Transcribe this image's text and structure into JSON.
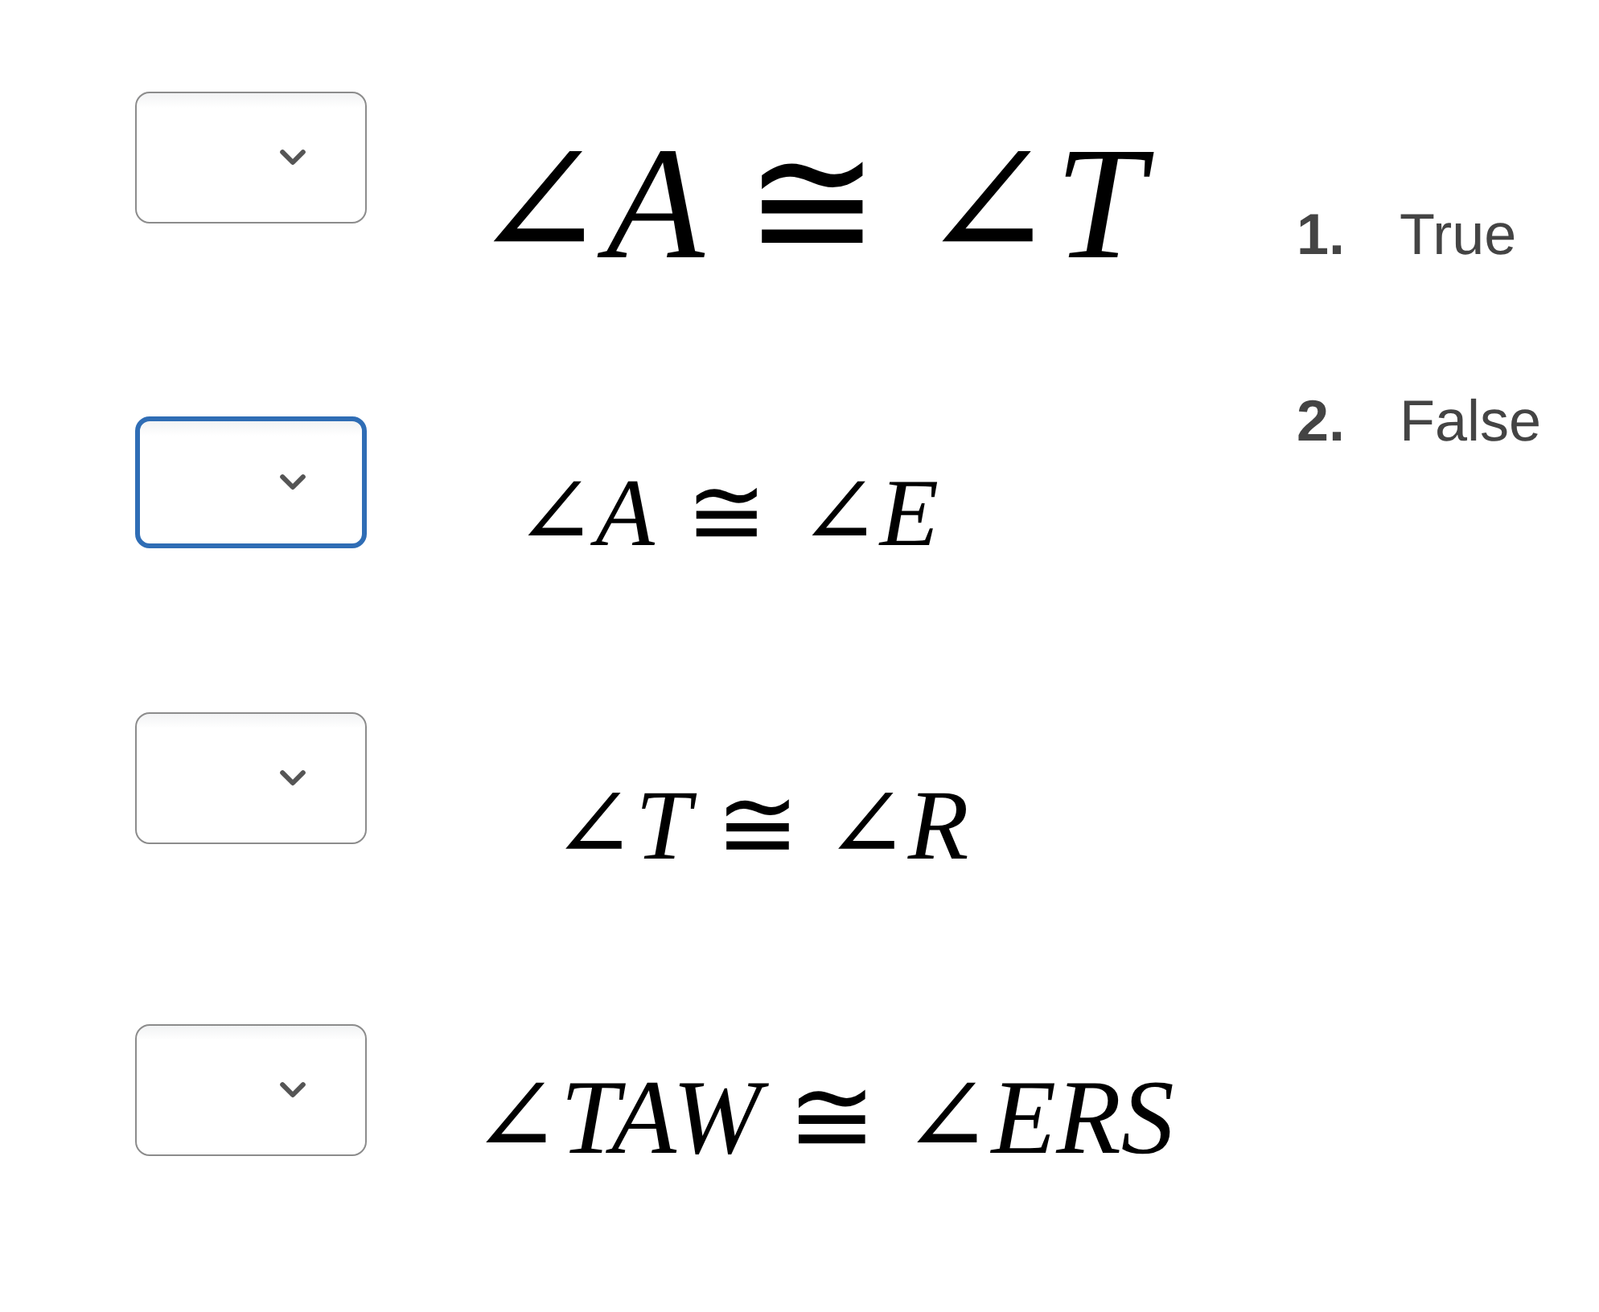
{
  "questions": [
    {
      "statement": "∠*A* ≅ ∠*T*",
      "dropdown": {
        "focused": false
      }
    },
    {
      "statement": "∠*A* ≅ ∠*E*",
      "dropdown": {
        "focused": true
      }
    },
    {
      "statement": "∠*T* ≅ ∠*R*",
      "dropdown": {
        "focused": false
      }
    },
    {
      "statement": "∠*TAW* ≅ ∠*ERS*",
      "dropdown": {
        "focused": false
      }
    }
  ],
  "options": [
    {
      "number": "1.",
      "label": "True"
    },
    {
      "number": "2.",
      "label": "False"
    }
  ]
}
